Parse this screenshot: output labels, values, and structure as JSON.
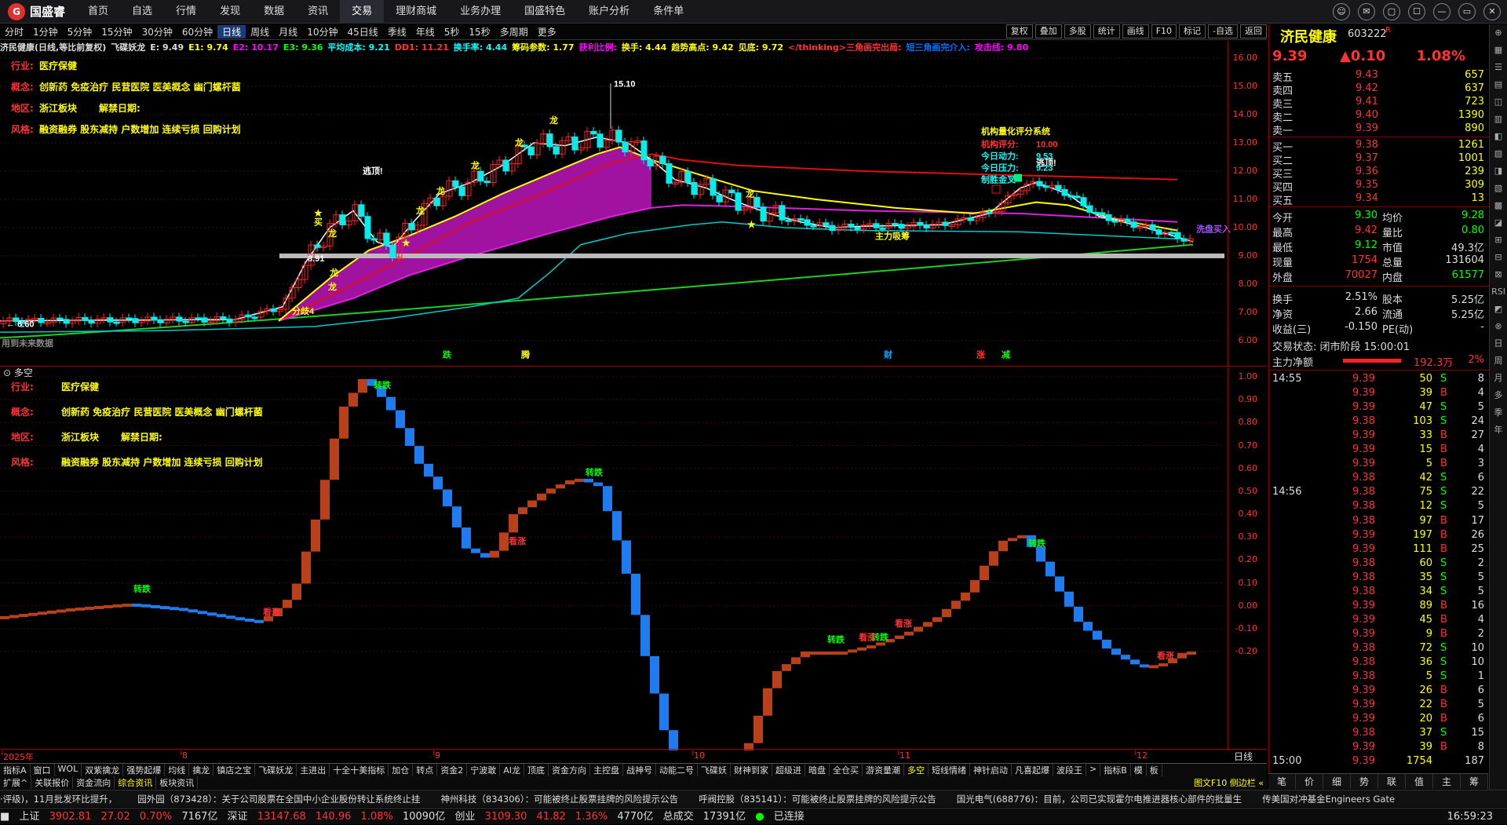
{
  "app": {
    "logo": "国盛睿",
    "logo_mark": "G",
    "menu": [
      "首页",
      "自选",
      "行情",
      "发现",
      "数据",
      "资讯",
      "交易",
      "理财商城",
      "业务办理",
      "国盛特色",
      "账户分析",
      "条件单"
    ],
    "active_menu": "交易",
    "win_buttons": [
      "☺",
      "✉",
      "▢",
      "☐",
      "—",
      "▭",
      "✕"
    ]
  },
  "periods": [
    "分时",
    "1分钟",
    "5分钟",
    "15分钟",
    "30分钟",
    "60分钟",
    "日线",
    "周线",
    "月线",
    "10分钟",
    "45日线",
    "季线",
    "年线",
    "5秒",
    "15秒",
    "多周期",
    "更多"
  ],
  "active_period": "日线",
  "right_buttons": [
    "复权",
    "叠加",
    "多股",
    "统计",
    "画线",
    "F10",
    "标记",
    "-自选",
    "返回"
  ],
  "indicator_line": [
    {
      "t": "济民健康(日线,等比前复权)",
      "c": "#ddd"
    },
    {
      "t": "飞碟妖龙",
      "c": "#ddd"
    },
    {
      "t": "E: 9.49",
      "c": "#ddd"
    },
    {
      "t": "E1: 9.74",
      "c": "#ff0"
    },
    {
      "t": "E2: 10.17",
      "c": "#f0f"
    },
    {
      "t": "E3: 9.36",
      "c": "#0f0"
    },
    {
      "t": "平均成本: 9.21",
      "c": "#0ff"
    },
    {
      "t": "DD1: 11.21",
      "c": "#f33"
    },
    {
      "t": "换手率: 4.44",
      "c": "#0ff"
    },
    {
      "t": "筹码参数: 1.77",
      "c": "#ff0"
    },
    {
      "t": "获利比例:",
      "c": "#f0f"
    },
    {
      "t": "换手: 4.44",
      "c": "#ff0"
    },
    {
      "t": "趋势高点: 9.42",
      "c": "#ff0"
    },
    {
      "t": "见底: 9.72",
      "c": "#ff0"
    },
    {
      "t": "</thinking>三角画完出局:",
      "c": "#f33"
    },
    {
      "t": "短三角画完介入:",
      "c": "#0070ff"
    },
    {
      "t": "攻击线: 9.80",
      "c": "#f0f"
    }
  ],
  "stock_info": [
    {
      "k": "行业:",
      "v": "医疗保健"
    },
    {
      "k": "概念:",
      "v": "创新药 免疫治疗 民营医院 医美概念 幽门螺杆菌"
    },
    {
      "k": "地区:",
      "v": "浙江板块",
      "extra": "解禁日期:"
    },
    {
      "k": "风格:",
      "v": "融资融券 股东减持 户数增加 连续亏损 回购计划"
    }
  ],
  "main_chart": {
    "price_ticks": [
      "16.00",
      "15.00",
      "14.00",
      "13.00",
      "12.00",
      "11.00",
      "10.00",
      "9.00",
      "8.00",
      "7.00",
      "6.00"
    ],
    "annotations": {
      "high": "15.10",
      "low": "6.60",
      "mid_low": "8.91",
      "dragon": "龙",
      "escape": "逃顶!",
      "buy": "买",
      "fenqi": "分歧4",
      "zhuli": "主力吸筹",
      "xipan": "洗盘买入",
      "no_data": "用到未来数据",
      "tie": "跌",
      "teng": "腾",
      "cai": "财",
      "zhang": "涨",
      "jian": "减"
    },
    "score_box": {
      "title": "机构量化评分系统",
      "rows": [
        {
          "k": "机构评分:",
          "v": "10.00"
        },
        {
          "k": "今日动力:",
          "v": "9.53"
        },
        {
          "k": "今日压力:",
          "v": "9.23"
        },
        {
          "k": "制胜金叉",
          "v": ""
        }
      ]
    }
  },
  "sub_chart": {
    "title": "多空",
    "ticks": [
      "1.00",
      "0.90",
      "0.80",
      "0.70",
      "0.60",
      "0.50",
      "0.40",
      "0.30",
      "0.20",
      "0.10",
      "0.00",
      "-0.10",
      "-0.20"
    ],
    "labels": {
      "turn_down": "转跌",
      "see_up": "看涨"
    }
  },
  "dates": [
    "2025年",
    "8",
    "9",
    "10",
    "11",
    "12"
  ],
  "date_corner": "日线",
  "bottom_tabs": [
    "指标A",
    "窗口",
    "WOL",
    "双紫擒龙",
    "强势起爆",
    "均线",
    "擒龙",
    "镇店之宝",
    "飞碟妖龙",
    "主进出",
    "十全十美指标",
    "加仓",
    "转点",
    "资金2",
    "宁波敢",
    "AI龙",
    "顶底",
    "资金方向",
    "主控盘",
    "战神号",
    "动能二号",
    "飞碟妖",
    "财神到家",
    "超级进",
    "暗盘",
    "全仓买",
    "游资量潮",
    "多空",
    "短线情绪",
    "神针启动",
    "凡喜起爆",
    "波段王",
    ">",
    "指标B",
    "模",
    "板"
  ],
  "active_bottom_tab": "多空",
  "bottom_tabs2": [
    "扩展^",
    "关联报价",
    "资金流向",
    "综合资讯",
    "板块资讯"
  ],
  "bottom_tabs2_right": "图文F10 侧边栏 «",
  "ticker": [
    "·评级)，11月批发环比提升，",
    "园外园（873428）：关于公司股票在全国中小企业股份转让系统终止挂",
    "神州科技（834306）：可能被终止股票挂牌的风险提示公告",
    "呼阀控股（835141）：可能被终止股票挂牌的风险提示公告",
    "国光电气(688776)：目前，公司已实现霍尔电推进器核心部件的批量生",
    "传美国对冲基金Engineers Gate"
  ],
  "statusbar": {
    "sh": {
      "name": "上证",
      "price": "3902.81",
      "chg": "27.02",
      "pct": "0.70%",
      "vol": "7167亿"
    },
    "sz": {
      "name": "深证",
      "price": "13147.68",
      "chg": "140.96",
      "pct": "1.08%",
      "vol": "10090亿"
    },
    "cy": {
      "name": "创业",
      "price": "3109.30",
      "chg": "41.82",
      "pct": "1.36%",
      "vol": "4770亿"
    },
    "total": {
      "name": "总成交",
      "vol": "17391亿"
    },
    "conn": "已连接",
    "time": "16:59:23"
  },
  "quote": {
    "name": "济民健康",
    "code": "603222",
    "badge": "R",
    "price": "9.39",
    "chg": "▲0.10",
    "pct": "1.08%",
    "asks": [
      {
        "l": "卖五",
        "p": "9.43",
        "v": "657"
      },
      {
        "l": "卖四",
        "p": "9.42",
        "v": "637"
      },
      {
        "l": "卖三",
        "p": "9.41",
        "v": "723"
      },
      {
        "l": "卖二",
        "p": "9.40",
        "v": "1390"
      },
      {
        "l": "卖一",
        "p": "9.39",
        "v": "890"
      }
    ],
    "bids": [
      {
        "l": "买一",
        "p": "9.38",
        "v": "1261"
      },
      {
        "l": "买二",
        "p": "9.37",
        "v": "1001"
      },
      {
        "l": "买三",
        "p": "9.36",
        "v": "239"
      },
      {
        "l": "买四",
        "p": "9.35",
        "v": "309"
      },
      {
        "l": "买五",
        "p": "9.34",
        "v": "13"
      }
    ],
    "stats": [
      {
        "k1": "今开",
        "v1": "9.30",
        "c1": "dn",
        "k2": "均价",
        "v2": "9.28",
        "c2": "dn"
      },
      {
        "k1": "最高",
        "v1": "9.42",
        "c1": "up",
        "k2": "量比",
        "v2": "0.80",
        "c2": "dn"
      },
      {
        "k1": "最低",
        "v1": "9.12",
        "c1": "dn",
        "k2": "市值",
        "v2": "49.3亿",
        "c2": "wh"
      },
      {
        "k1": "现量",
        "v1": "1754",
        "c1": "up",
        "k2": "总量",
        "v2": "131604",
        "c2": "wh"
      },
      {
        "k1": "外盘",
        "v1": "70027",
        "c1": "up",
        "k2": "内盘",
        "v2": "61577",
        "c2": "dn"
      },
      {
        "k1": "换手",
        "v1": "2.51%",
        "c1": "wh",
        "k2": "股本",
        "v2": "5.25亿",
        "c2": "wh"
      },
      {
        "k1": "净资",
        "v1": "2.66",
        "c1": "wh",
        "k2": "流通",
        "v2": "5.25亿",
        "c2": "wh"
      },
      {
        "k1": "收益(三)",
        "v1": "-0.150",
        "c1": "wh",
        "k2": "PE(动)",
        "v2": "-",
        "c2": "wh"
      }
    ],
    "state": "交易状态: 闭市阶段 15:00:01",
    "netflow_label": "主力净额",
    "netflow_value": "192.3万",
    "netflow_pct": "2%",
    "ticks": [
      {
        "t": "14:55",
        "p": "9.39",
        "v": "50",
        "s": "S",
        "n": "8"
      },
      {
        "t": "",
        "p": "9.39",
        "v": "39",
        "s": "B",
        "n": "4"
      },
      {
        "t": "",
        "p": "9.39",
        "v": "47",
        "s": "S",
        "n": "5"
      },
      {
        "t": "",
        "p": "9.38",
        "v": "103",
        "s": "S",
        "n": "24"
      },
      {
        "t": "",
        "p": "9.39",
        "v": "33",
        "s": "B",
        "n": "27"
      },
      {
        "t": "",
        "p": "9.39",
        "v": "15",
        "s": "B",
        "n": "4"
      },
      {
        "t": "",
        "p": "9.39",
        "v": "5",
        "s": "B",
        "n": "3"
      },
      {
        "t": "",
        "p": "9.38",
        "v": "42",
        "s": "S",
        "n": "6"
      },
      {
        "t": "14:56",
        "p": "9.38",
        "v": "75",
        "s": "S",
        "n": "22"
      },
      {
        "t": "",
        "p": "9.38",
        "v": "12",
        "s": "S",
        "n": "5"
      },
      {
        "t": "",
        "p": "9.38",
        "v": "97",
        "s": "B",
        "n": "17"
      },
      {
        "t": "",
        "p": "9.39",
        "v": "197",
        "s": "B",
        "n": "26"
      },
      {
        "t": "",
        "p": "9.39",
        "v": "111",
        "s": "B",
        "n": "25"
      },
      {
        "t": "",
        "p": "9.38",
        "v": "60",
        "s": "S",
        "n": "2"
      },
      {
        "t": "",
        "p": "9.38",
        "v": "35",
        "s": "S",
        "n": "5"
      },
      {
        "t": "",
        "p": "9.38",
        "v": "34",
        "s": "S",
        "n": "5"
      },
      {
        "t": "",
        "p": "9.39",
        "v": "89",
        "s": "B",
        "n": "16"
      },
      {
        "t": "",
        "p": "9.39",
        "v": "45",
        "s": "B",
        "n": "4"
      },
      {
        "t": "",
        "p": "9.39",
        "v": "9",
        "s": "B",
        "n": "2"
      },
      {
        "t": "",
        "p": "9.38",
        "v": "72",
        "s": "S",
        "n": "10"
      },
      {
        "t": "",
        "p": "9.38",
        "v": "36",
        "s": "S",
        "n": "10"
      },
      {
        "t": "",
        "p": "9.38",
        "v": "5",
        "s": "S",
        "n": "1"
      },
      {
        "t": "",
        "p": "9.39",
        "v": "26",
        "s": "B",
        "n": "6"
      },
      {
        "t": "",
        "p": "9.39",
        "v": "22",
        "s": "B",
        "n": "5"
      },
      {
        "t": "",
        "p": "9.39",
        "v": "20",
        "s": "B",
        "n": "6"
      },
      {
        "t": "",
        "p": "9.38",
        "v": "37",
        "s": "S",
        "n": "15"
      },
      {
        "t": "",
        "p": "9.39",
        "v": "39",
        "s": "B",
        "n": "8"
      },
      {
        "t": "15:00",
        "p": "9.39",
        "v": "1754",
        "s": "",
        "n": "187"
      }
    ],
    "tabs": [
      "笔",
      "价",
      "细",
      "势",
      "联",
      "值",
      "主",
      "筹"
    ]
  },
  "sidebar": [
    "⊕",
    "▦",
    "☰",
    "▤",
    "◫",
    "▥",
    "◧",
    "▨",
    "◨",
    "▧",
    "▩",
    "◪",
    "⊞",
    "⊟",
    "⊠",
    "RSI",
    "◩",
    "⊗",
    "日",
    "周",
    "月",
    "多",
    "季",
    "年"
  ]
}
